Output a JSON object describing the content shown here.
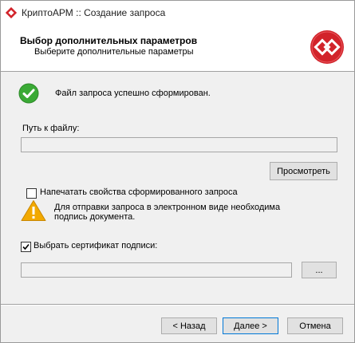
{
  "window": {
    "title": "КриптоАРМ :: Создание запроса"
  },
  "header": {
    "title": "Выбор дополнительных параметров",
    "subtitle": "Выберите дополнительные параметры"
  },
  "status": {
    "message": "Файл запроса успешно сформирован."
  },
  "file_path": {
    "label": "Путь к файлу:",
    "value": "",
    "browse_label": "Просмотреть"
  },
  "print_option": {
    "label": "Напечатать свойства сформированного запроса",
    "checked": false
  },
  "warning": {
    "line1": "Для отправки запроса в электронном виде необходима",
    "line2": "подпись документа."
  },
  "sign_option": {
    "label": "Выбрать сертификат подписи:",
    "checked": true,
    "value": "",
    "browse_label": "..."
  },
  "footer": {
    "back_label": "< Назад",
    "next_label": "Далее >",
    "cancel_label": "Отмена"
  },
  "colors": {
    "accent": "#0078d7",
    "success": "#3aaa35",
    "warning": "#f2a900",
    "brand": "#d2232a"
  }
}
